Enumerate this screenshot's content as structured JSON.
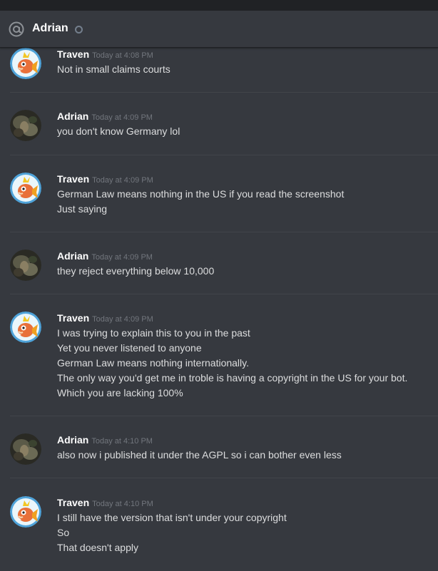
{
  "header": {
    "title": "Adrian",
    "status_icon": "offline-status-ring",
    "mention_icon": "at-sign-icon"
  },
  "messages": [
    {
      "author": "Traven",
      "timestamp": "Today at 4:08 PM",
      "avatar": "magikarp-avatar",
      "lines": [
        "Not in small claims courts"
      ]
    },
    {
      "author": "Adrian",
      "timestamp": "Today at 4:09 PM",
      "avatar": "dark-photo-avatar",
      "lines": [
        "you don't know Germany lol"
      ]
    },
    {
      "author": "Traven",
      "timestamp": "Today at 4:09 PM",
      "avatar": "magikarp-avatar",
      "lines": [
        "German Law means nothing in the US if you read the screenshot",
        "Just saying"
      ]
    },
    {
      "author": "Adrian",
      "timestamp": "Today at 4:09 PM",
      "avatar": "dark-photo-avatar",
      "lines": [
        "they reject everything below 10,000"
      ]
    },
    {
      "author": "Traven",
      "timestamp": "Today at 4:09 PM",
      "avatar": "magikarp-avatar",
      "lines": [
        "I was trying to explain this to you in the past",
        "Yet you never listened to anyone",
        "German Law means nothing internationally.",
        "The only way you'd get me in troble is having a copyright in the US for your bot.",
        "Which you are lacking 100%"
      ]
    },
    {
      "author": "Adrian",
      "timestamp": "Today at 4:10 PM",
      "avatar": "dark-photo-avatar",
      "lines": [
        "also now i published it under the AGPL so i can bother even less"
      ]
    },
    {
      "author": "Traven",
      "timestamp": "Today at 4:10 PM",
      "avatar": "magikarp-avatar",
      "lines": [
        "I still have the version that isn't under your copyright",
        "So",
        "That doesn't apply"
      ]
    }
  ],
  "colors": {
    "background": "#36393f",
    "header_title": "#ffffff",
    "text": "#dcddde",
    "timestamp": "#72767d",
    "divider": "#42454a",
    "magikarp_bg": "#4fa3d9",
    "magikarp_body": "#e8703a"
  }
}
